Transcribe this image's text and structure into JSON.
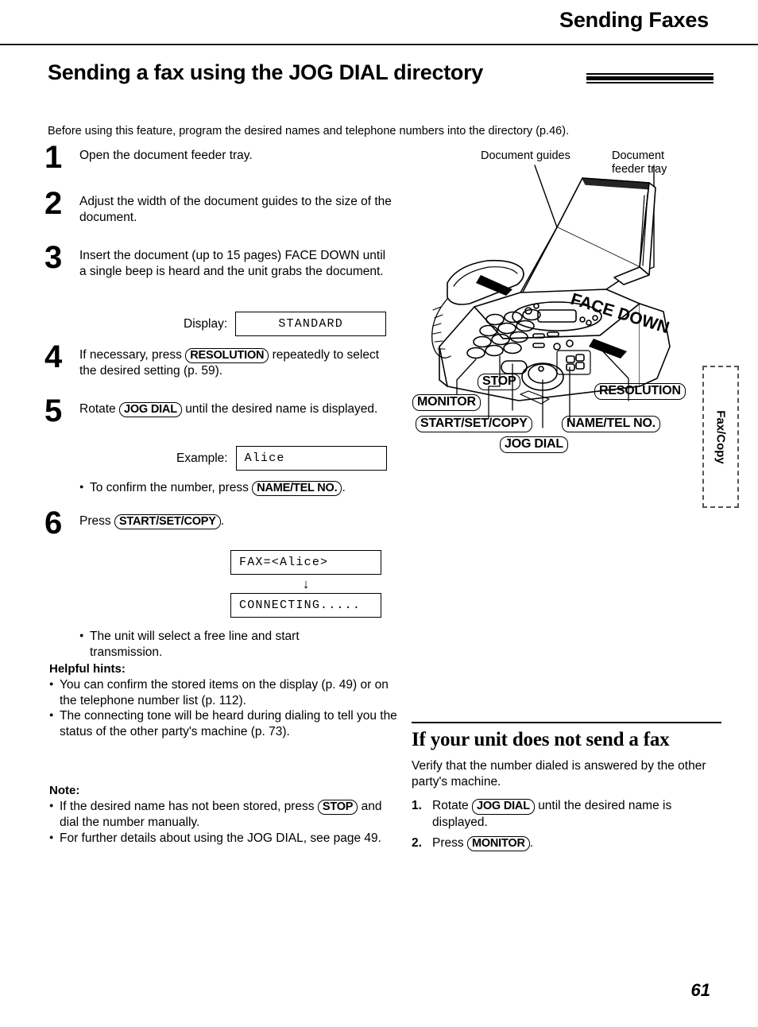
{
  "header": {
    "running_title": "Sending Faxes"
  },
  "title": {
    "text": "Sending a fax using the JOG DIAL directory"
  },
  "intro": "Before using this feature, program the desired names and telephone numbers into the directory (p.46).",
  "steps": [
    {
      "number": "1",
      "text": "Open the document feeder tray."
    },
    {
      "number": "2",
      "text": "Adjust the width of the document guides to the size of the document."
    },
    {
      "number": "3",
      "text": "Insert the document (up to 15 pages) FACE DOWN until a single beep is heard and the unit grabs the document."
    },
    {
      "number": "4",
      "text_before": "If necessary, press",
      "key": "RESOLUTION",
      "text_after": "repeatedly to select the desired setting (p. 59)."
    },
    {
      "number": "5",
      "text_before": "Rotate",
      "key": "JOG DIAL",
      "text_after": "until the desired name is displayed."
    },
    {
      "number": "6",
      "text_before": "Press",
      "key": "START/SET/COPY",
      "text_after": "."
    }
  ],
  "displays": {
    "standard_label": "Display:",
    "standard_value": "STANDARD",
    "example_label": "Example:",
    "example_value": "Alice",
    "fax_value": "FAX=<Alice>",
    "arrow": "↓",
    "connecting_value": "CONNECTING....."
  },
  "bullets": {
    "confirm_before": "To confirm the number, press",
    "confirm_key": "NAME/TEL NO.",
    "confirm_after": ".",
    "free_line": "The unit will select a free line and start transmission."
  },
  "hints": {
    "label": "Helpful hints:",
    "items": [
      "You can confirm the stored items on the display (p. 49) or on the telephone number list (p. 112).",
      "The connecting tone will be heard during dialing to tell you the status of the other party's machine (p. 73)."
    ]
  },
  "note": {
    "label": "Note:",
    "item1_before": "If the desired name has not been stored, press",
    "item1_key": "STOP",
    "item1_after": "and dial the number manually.",
    "item2": "For further details about using the JOG DIAL, see page 49."
  },
  "illustration": {
    "label_document_guides": "Document guides",
    "label_document_feeder_tray": "Document\nfeeder tray",
    "label_face_down": "FACE DOWN",
    "callouts": [
      {
        "label": "STOP"
      },
      {
        "label": "MONITOR"
      },
      {
        "label": "START/SET/COPY"
      },
      {
        "label": "JOG DIAL"
      },
      {
        "label": "NAME/TEL NO."
      },
      {
        "label": "RESOLUTION"
      }
    ]
  },
  "not_send": {
    "heading": "If your unit does not send a fax",
    "intro": "Verify that the number dialed is answered by the other party's machine.",
    "steps": [
      {
        "number": "1.",
        "text_before": "Rotate",
        "key": "JOG DIAL",
        "text_after": "until the desired name is displayed."
      },
      {
        "number": "2.",
        "text_before": "Press",
        "key": "MONITOR",
        "text_after": "."
      }
    ]
  },
  "side_tab": {
    "label": "Fax/Copy"
  },
  "page_number": "61"
}
